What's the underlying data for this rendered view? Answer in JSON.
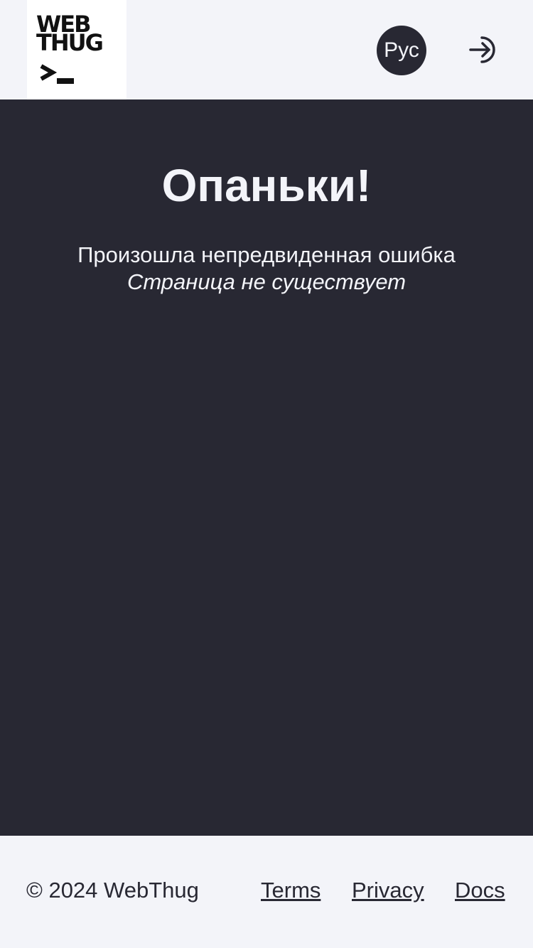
{
  "header": {
    "logo": {
      "line1": "WEB",
      "line2": "THUG",
      "prompt_icon": "terminal-prompt-icon"
    },
    "language_button": "Рус",
    "login_icon": "login-arrow-icon"
  },
  "main": {
    "title": "Опаньки!",
    "message": "Произошла непредвиденная ошибка",
    "detail": "Страница не существует"
  },
  "footer": {
    "copyright": "© 2024 WebThug",
    "links": [
      {
        "label": "Terms"
      },
      {
        "label": "Privacy"
      },
      {
        "label": "Docs"
      }
    ]
  },
  "colors": {
    "dark": "#282833",
    "light": "#f3f4f9",
    "logo_bg": "#ffffff"
  }
}
